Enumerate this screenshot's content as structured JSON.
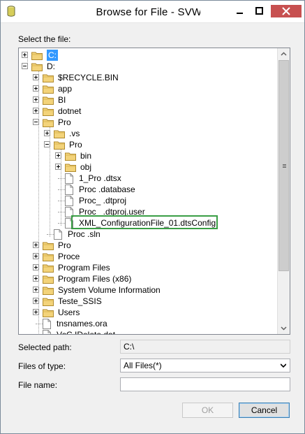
{
  "window": {
    "title": "Browse for File - SVWS",
    "app_icon": "database-cylinder-icon",
    "controls": [
      "minimize-icon",
      "maximize-icon",
      "close-icon"
    ]
  },
  "select_file_label": "Select the file:",
  "tree": [
    {
      "label": "C:",
      "type": "drive",
      "expander": "plus",
      "level": 0,
      "selected": true
    },
    {
      "label": "D:",
      "type": "drive",
      "expander": "minus",
      "level": 0
    },
    {
      "label": "$RECYCLE.BIN",
      "type": "folder",
      "expander": "plus",
      "level": 1
    },
    {
      "label": "app",
      "type": "folder",
      "expander": "plus",
      "level": 1
    },
    {
      "label": "BI",
      "type": "folder",
      "expander": "plus",
      "level": 1
    },
    {
      "label": "dotnet",
      "type": "folder",
      "expander": "plus",
      "level": 1
    },
    {
      "label": "Pro",
      "type": "folder",
      "expander": "minus",
      "level": 1
    },
    {
      "label": ".vs",
      "type": "folder",
      "expander": "plus",
      "level": 2
    },
    {
      "label": "Pro",
      "type": "folder",
      "expander": "minus",
      "level": 2
    },
    {
      "label": "bin",
      "type": "folder",
      "expander": "plus",
      "level": 3
    },
    {
      "label": "obj",
      "type": "folder",
      "expander": "plus",
      "level": 3
    },
    {
      "label": "1_Pro                    .dtsx",
      "type": "file",
      "level": 3
    },
    {
      "label": "Proc               .database",
      "type": "file",
      "level": 3
    },
    {
      "label": "Proc_              .dtproj",
      "type": "file",
      "level": 3
    },
    {
      "label": "Proc_              .dtproj.user",
      "type": "file",
      "level": 3
    },
    {
      "label": "XML_ConfigurationFile_01.dtsConfig",
      "type": "file",
      "level": 3,
      "highlighted": true
    },
    {
      "label": "Proc                  .sln",
      "type": "file",
      "level": 2
    },
    {
      "label": "Pro",
      "type": "folder",
      "expander": "plus",
      "level": 1
    },
    {
      "label": "Proce",
      "type": "folder",
      "expander": "plus",
      "level": 1
    },
    {
      "label": "Program Files",
      "type": "folder",
      "expander": "plus",
      "level": 1
    },
    {
      "label": "Program Files (x86)",
      "type": "folder",
      "expander": "plus",
      "level": 1
    },
    {
      "label": "System Volume Information",
      "type": "folder",
      "expander": "plus",
      "level": 1
    },
    {
      "label": "Teste_SSIS",
      "type": "folder",
      "expander": "plus",
      "level": 1
    },
    {
      "label": "Users",
      "type": "folder",
      "expander": "plus",
      "level": 1
    },
    {
      "label": "tnsnames.ora",
      "type": "file",
      "level": 1
    },
    {
      "label": "VsC.IDelete.dat",
      "type": "file",
      "level": 1
    }
  ],
  "selected_path": {
    "label": "Selected path:",
    "value": "C:\\"
  },
  "files_of_type": {
    "label": "Files of type:",
    "value": "All Files(*)"
  },
  "file_name": {
    "label": "File name:",
    "value": ""
  },
  "buttons": {
    "ok": "OK",
    "cancel": "Cancel"
  },
  "colors": {
    "highlight_box": "#3a9e45",
    "selection": "#3399ff",
    "close_button": "#c75050"
  }
}
